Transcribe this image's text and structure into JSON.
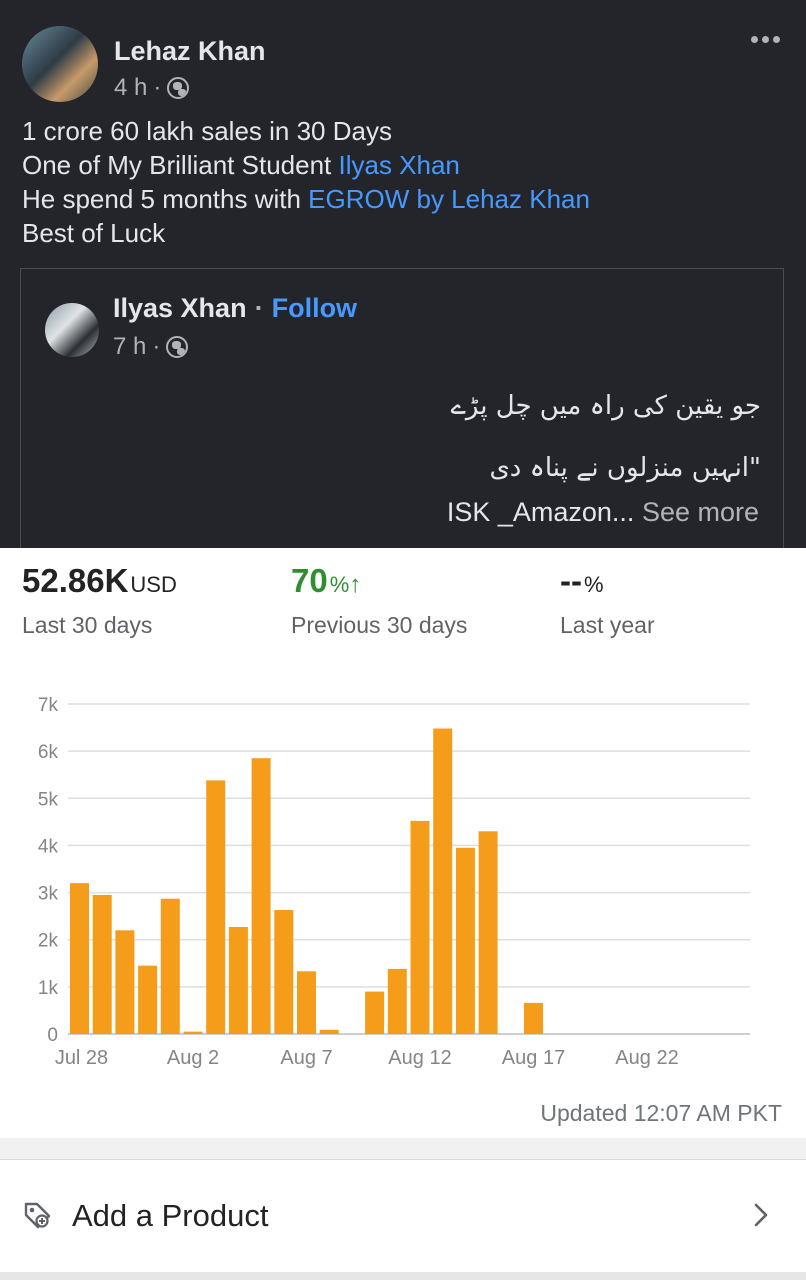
{
  "post": {
    "author": "Lehaz Khan",
    "time": "4 h",
    "dot": "·",
    "lines": {
      "l1": "1 crore 60 lakh sales in 30 Days",
      "l2_prefix": "One of My Brilliant Student ",
      "l2_link": "Ilyas Xhan",
      "l3_prefix": "He spend 5 months with ",
      "l3_link": "EGROW by Lehaz Khan",
      "l4": "Best of Luck"
    }
  },
  "shared": {
    "author": "Ilyas Xhan",
    "sep": "·",
    "follow": "Follow",
    "time": "7 h",
    "dot": "·",
    "urdu_line1": "جو یقین کی راہ میں چل پڑے",
    "urdu_line2": "\"انہیں منزلوں نے پناہ دی",
    "snippet": "ISK _Amazon... ",
    "see_more": "See more"
  },
  "stats": {
    "sales": "52.86K",
    "sales_unit": "USD",
    "sales_label": "Last 30 days",
    "growth": "70",
    "growth_unit": "%",
    "growth_arrow": "↑",
    "growth_label": "Previous 30 days",
    "last_year": "--",
    "last_year_unit": "%",
    "last_year_label": "Last year"
  },
  "chart_data": {
    "type": "bar",
    "color": "#f59c1a",
    "ylim": [
      0,
      7000
    ],
    "yticks": [
      "0",
      "1k",
      "2k",
      "3k",
      "4k",
      "5k",
      "6k",
      "7k"
    ],
    "xticks": [
      "Jul 28",
      "Aug 2",
      "Aug 7",
      "Aug 12",
      "Aug 17",
      "Aug 22"
    ],
    "categories": [
      "Jul 28",
      "Jul 29",
      "Jul 30",
      "Jul 31",
      "Aug 1",
      "Aug 2",
      "Aug 3",
      "Aug 4",
      "Aug 5",
      "Aug 6",
      "Aug 7",
      "Aug 8",
      "Aug 9",
      "Aug 10",
      "Aug 11",
      "Aug 12",
      "Aug 13",
      "Aug 14",
      "Aug 15",
      "Aug 16",
      "Aug 17",
      "Aug 18",
      "Aug 19",
      "Aug 20",
      "Aug 21",
      "Aug 22",
      "Aug 23",
      "Aug 24",
      "Aug 25",
      "Aug 26"
    ],
    "values": [
      3200,
      2950,
      2200,
      1450,
      2870,
      50,
      5380,
      2270,
      5850,
      2630,
      1330,
      90,
      0,
      900,
      1380,
      4520,
      6480,
      3950,
      4300,
      0,
      660,
      0,
      0,
      0,
      0,
      0,
      0,
      0,
      0,
      0
    ]
  },
  "updated": "Updated 12:07 AM PKT",
  "footer": {
    "add_product": "Add a Product"
  }
}
